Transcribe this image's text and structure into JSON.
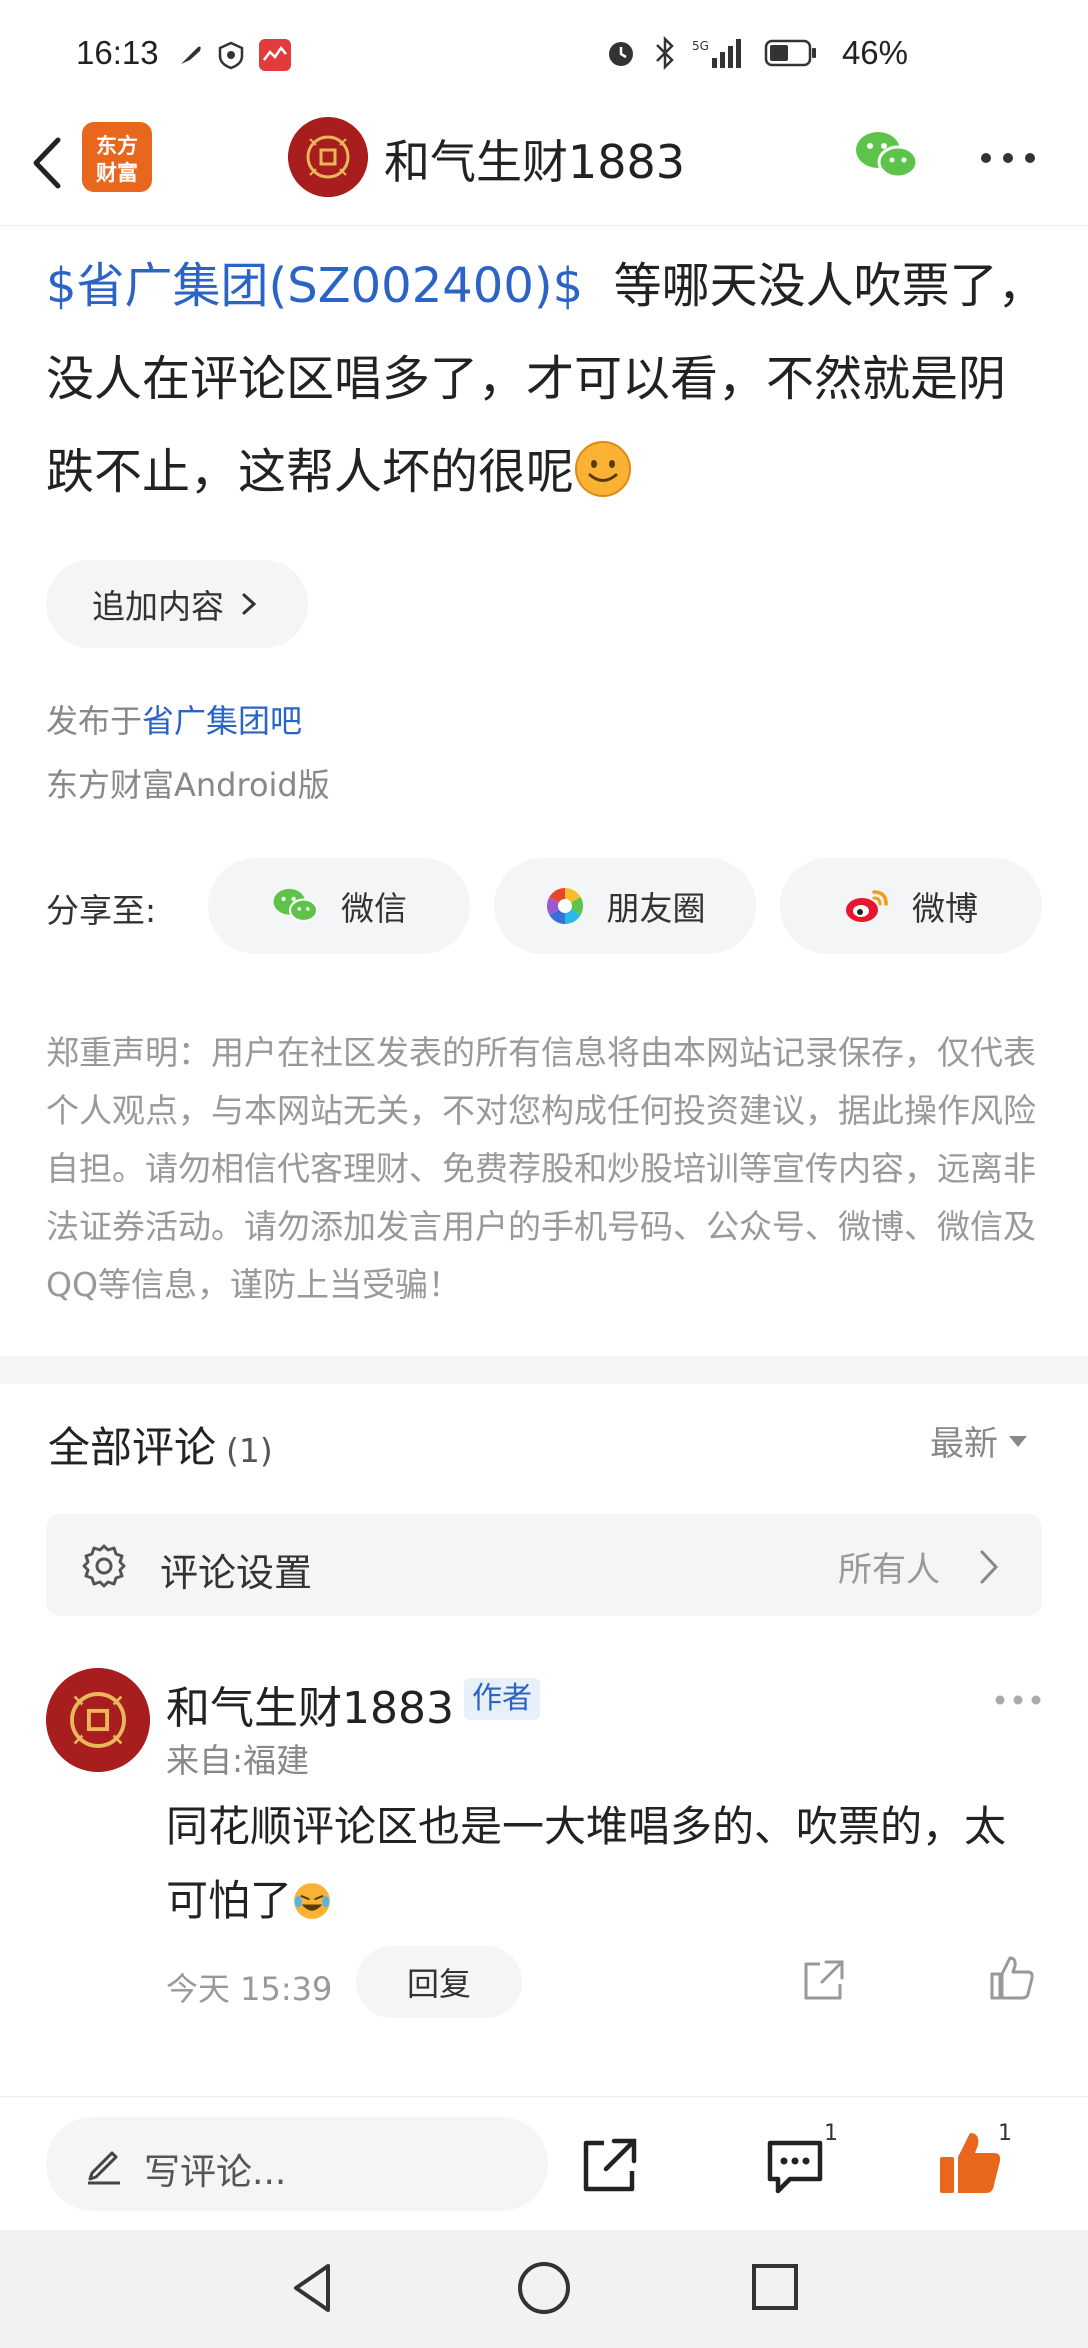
{
  "status_bar": {
    "time": "16:13",
    "battery_percent": "46%"
  },
  "nav": {
    "logo_text": "东方财富",
    "title": "和气生财1883"
  },
  "post": {
    "stock_link": "$省广集团(SZ002400)$",
    "body_text": "等哪天没人吹票了，没人在评论区唱多了，才可以看，不然就是阴跌不止，这帮人坏的很呢",
    "append_label": "追加内容",
    "published_prefix": "发布于",
    "published_forum": "省广集团吧",
    "client": "东方财富Android版"
  },
  "share": {
    "label": "分享至:",
    "wechat": "微信",
    "moments": "朋友圈",
    "weibo": "微博"
  },
  "disclaimer": "郑重声明：用户在社区发表的所有信息将由本网站记录保存，仅代表个人观点，与本网站无关，不对您构成任何投资建议，据此操作风险自担。请勿相信代客理财、免费荐股和炒股培训等宣传内容，远离非法证券活动。请勿添加发言用户的手机号码、公众号、微博、微信及QQ等信息，谨防上当受骗！",
  "comments": {
    "title": "全部评论",
    "count": "(1)",
    "sort_label": "最新",
    "settings_label": "评论设置",
    "settings_value": "所有人",
    "items": [
      {
        "author": "和气生财1883",
        "badge": "作者",
        "location": "来自:福建",
        "text": "同花顺评论区也是一大堆唱多的、吹票的，太可怕了",
        "time": "今天 15:39",
        "reply_label": "回复"
      }
    ]
  },
  "bottom_bar": {
    "write_placeholder": "写评论...",
    "comment_count": "1",
    "like_count": "1"
  },
  "colors": {
    "accent_blue": "#2b63c6",
    "like_orange": "#e8671c",
    "avatar_red": "#a81d1d",
    "wechat_green": "#5dc34a"
  }
}
